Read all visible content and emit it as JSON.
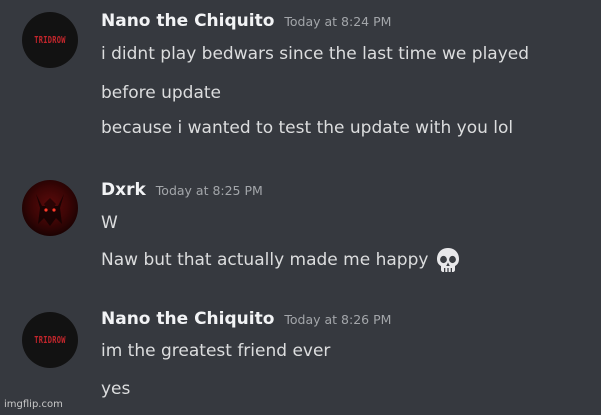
{
  "messages": [
    {
      "username": "Nano the Chiquito",
      "timestamp": "Today at 8:24 PM",
      "avatar_text": "TRIDROW",
      "lines": [
        "i didnt play bedwars since the last time we played",
        "before update",
        "because i wanted to test the update with you lol"
      ]
    },
    {
      "username": "Dxrk",
      "timestamp": "Today at 8:25 PM",
      "lines": [
        "W",
        "Naw but that actually made me happy"
      ],
      "emoji": "skull-emoji"
    },
    {
      "username": "Nano the Chiquito",
      "timestamp": "Today at 8:26 PM",
      "avatar_text": "TRIDROW",
      "lines": [
        "im the greatest friend ever",
        "yes"
      ]
    }
  ],
  "watermark": "imgflip.com",
  "colors": {
    "background": "#36393f",
    "username": "#f2f3f5",
    "message_text": "#dcddde",
    "timestamp": "#a3a6aa"
  }
}
